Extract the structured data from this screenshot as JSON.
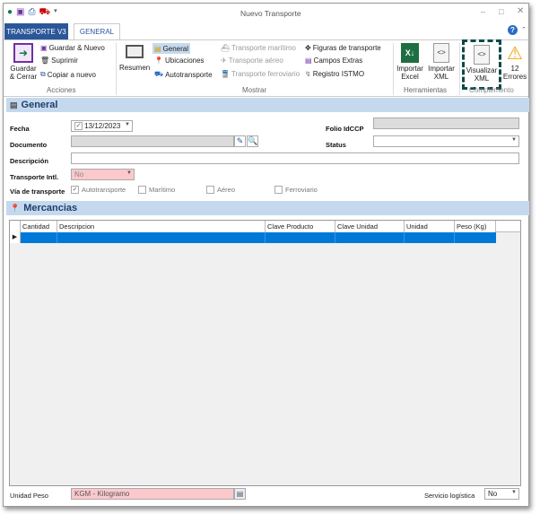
{
  "window": {
    "title": "Nuevo Transporte"
  },
  "quick_access": [
    "app-icon",
    "save-icon",
    "print-icon",
    "truck-icon",
    "customize-icon"
  ],
  "tabs": [
    {
      "label": "TRANSPORTE V3"
    },
    {
      "label": "GENERAL"
    }
  ],
  "ribbon": {
    "acciones": {
      "label": "Acciones",
      "guardar_cerrar": "Guardar\n& Cerrar",
      "guardar_nuevo": "Guardar & Nuevo",
      "suprimir": "Suprimir",
      "copiar": "Copiar a nuevo"
    },
    "mostrar": {
      "label": "Mostrar",
      "resumen": "Resumen",
      "general": "General",
      "ubicaciones": "Ubicaciones",
      "autotransporte": "Autotransporte",
      "maritimo": "Transporte marítimo",
      "aereo": "Transporte aéreo",
      "ferroviario": "Transporte ferroviario",
      "figuras": "Figuras de transporte",
      "campos": "Campos Extras",
      "istmo": "Registro ISTMO"
    },
    "herramientas": {
      "label": "Herramientas",
      "importar_excel": "Importar Excel",
      "importar_xml": "Importar XML"
    },
    "complemento": {
      "label": "Complemento",
      "visualizar_xml": "Visualizar XML",
      "errores": "12 Errores"
    }
  },
  "general": {
    "title": "General",
    "fecha_label": "Fecha",
    "fecha_value": "13/12/2023",
    "folio_label": "Folio IdCCP",
    "folio_value": "",
    "documento_label": "Documento",
    "documento_value": "",
    "status_label": "Status",
    "status_value": "",
    "descripcion_label": "Descripción",
    "descripcion_value": "",
    "transporte_intl_label": "Transporte Intl.",
    "transporte_intl_value": "No",
    "via_label": "Vía de transporte",
    "vias": [
      {
        "label": "Autotransporte",
        "checked": true
      },
      {
        "label": "Marítimo",
        "checked": false
      },
      {
        "label": "Aéreo",
        "checked": false
      },
      {
        "label": "Ferroviario",
        "checked": false
      }
    ]
  },
  "mercancias": {
    "title": "Mercancias",
    "columns": [
      "Cantidad",
      "Descripcion",
      "Clave Producto",
      "Clave Unidad",
      "Unidad",
      "Peso (Kg)"
    ],
    "rows": [
      [
        "",
        "",
        "",
        "",
        "",
        ""
      ]
    ]
  },
  "footer": {
    "unidad_peso_label": "Unidad Peso",
    "unidad_peso_value": "KGM - Kilogramo",
    "servicio_label": "Servicio logística",
    "servicio_value": "No"
  },
  "colors": {
    "accent": "#2b579a",
    "section": "#c5d9ee",
    "selected_row": "#0078d7",
    "required": "#fcc8cc"
  }
}
